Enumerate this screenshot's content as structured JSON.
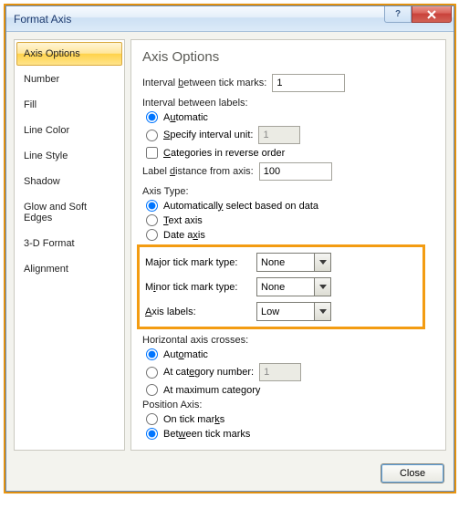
{
  "window": {
    "title": "Format Axis",
    "help_label": "?",
    "close_label": "X"
  },
  "sidebar": {
    "items": [
      {
        "label": "Axis Options",
        "selected": true
      },
      {
        "label": "Number",
        "selected": false
      },
      {
        "label": "Fill",
        "selected": false
      },
      {
        "label": "Line Color",
        "selected": false
      },
      {
        "label": "Line Style",
        "selected": false
      },
      {
        "label": "Shadow",
        "selected": false
      },
      {
        "label": "Glow and Soft Edges",
        "selected": false
      },
      {
        "label": "3-D Format",
        "selected": false
      },
      {
        "label": "Alignment",
        "selected": false
      }
    ]
  },
  "panel": {
    "title": "Axis Options",
    "interval_marks_label": "Interval between tick marks:",
    "interval_marks_value": "1",
    "interval_labels_header": "Interval between labels:",
    "auto_label": "Automatic",
    "specify_label": "Specify interval unit:",
    "specify_value": "1",
    "reverse_label": "Categories in reverse order",
    "label_distance_label": "Label distance from axis:",
    "label_distance_value": "100",
    "axis_type_header": "Axis Type:",
    "axis_type_auto": "Automatically select based on data",
    "axis_type_text": "Text axis",
    "axis_type_date": "Date axis",
    "major_tick_label": "Major tick mark type:",
    "major_tick_value": "None",
    "minor_tick_label": "Minor tick mark type:",
    "minor_tick_value": "None",
    "axis_labels_label": "Axis labels:",
    "axis_labels_value": "Low",
    "horiz_crosses_header": "Horizontal axis crosses:",
    "horiz_auto": "Automatic",
    "horiz_cat_label": "At category number:",
    "horiz_cat_value": "1",
    "horiz_max": "At maximum category",
    "position_header": "Position Axis:",
    "position_on": "On tick marks",
    "position_between": "Between tick marks"
  },
  "footer": {
    "close_label": "Close"
  }
}
